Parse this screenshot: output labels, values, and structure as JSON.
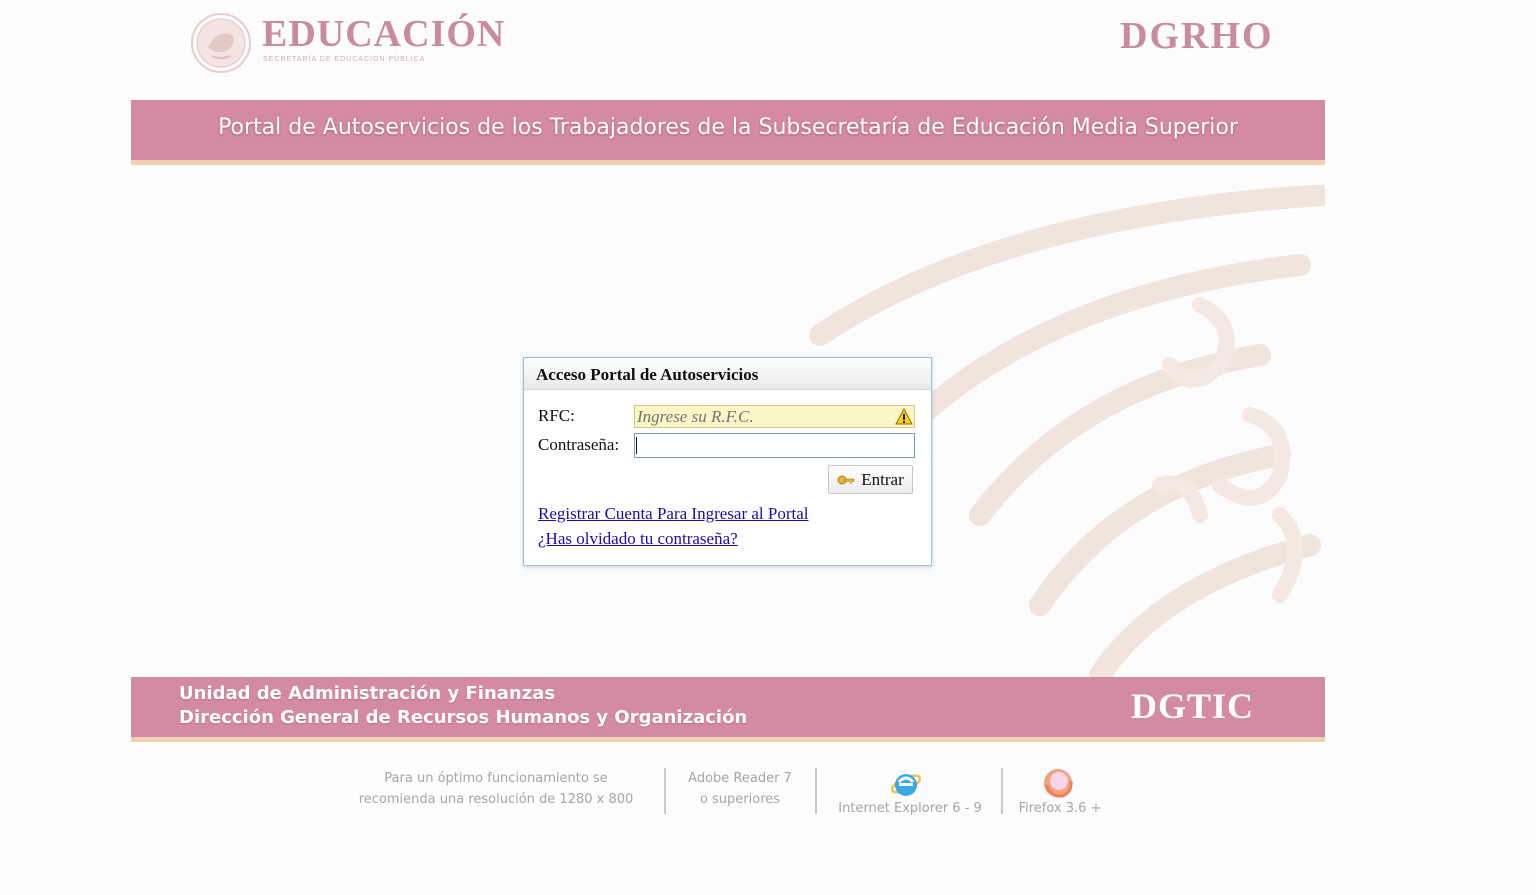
{
  "header": {
    "brand_title": "EDUCACIÓN",
    "brand_subtitle": "SECRETARÍA DE EDUCACIÓN PÚBLICA",
    "right_logo": "DGRHO",
    "seal_icon": "mexico-seal-icon"
  },
  "banner": {
    "title": "Portal de Autoservicios de los Trabajadores de la Subsecretaría de Educación Media Superior"
  },
  "login": {
    "heading": "Acceso Portal de Autoservicios",
    "rfc_label": "RFC:",
    "rfc_placeholder": "Ingrese su R.F.C.",
    "password_label": "Contraseña:",
    "password_value": "",
    "submit_label": "Entrar",
    "submit_icon": "key-icon",
    "warning_icon": "warning-icon",
    "register_link": "Registrar Cuenta Para Ingresar al Portal",
    "forgot_link": "¿Has olvidado tu contraseña?"
  },
  "footer": {
    "line1": "Unidad de Administración y Finanzas",
    "line2": "Dirección General de Recursos Humanos y Organización",
    "right_logo": "DGTIC"
  },
  "requirements": {
    "resolution_line1": "Para un óptimo funcionamiento se",
    "resolution_line2": "recomienda una resolución de 1280 x 800",
    "adobe_line1": "Adobe Reader  7",
    "adobe_line2": "o superiores",
    "ie_label": "Internet Explorer 6 - 9",
    "firefox_label": "Firefox 3.6 +"
  },
  "colors": {
    "brand_pink": "#d48aa3",
    "brand_text": "#c98ba0",
    "accent_band": "#ecd2b3",
    "link": "#1a0dab"
  }
}
